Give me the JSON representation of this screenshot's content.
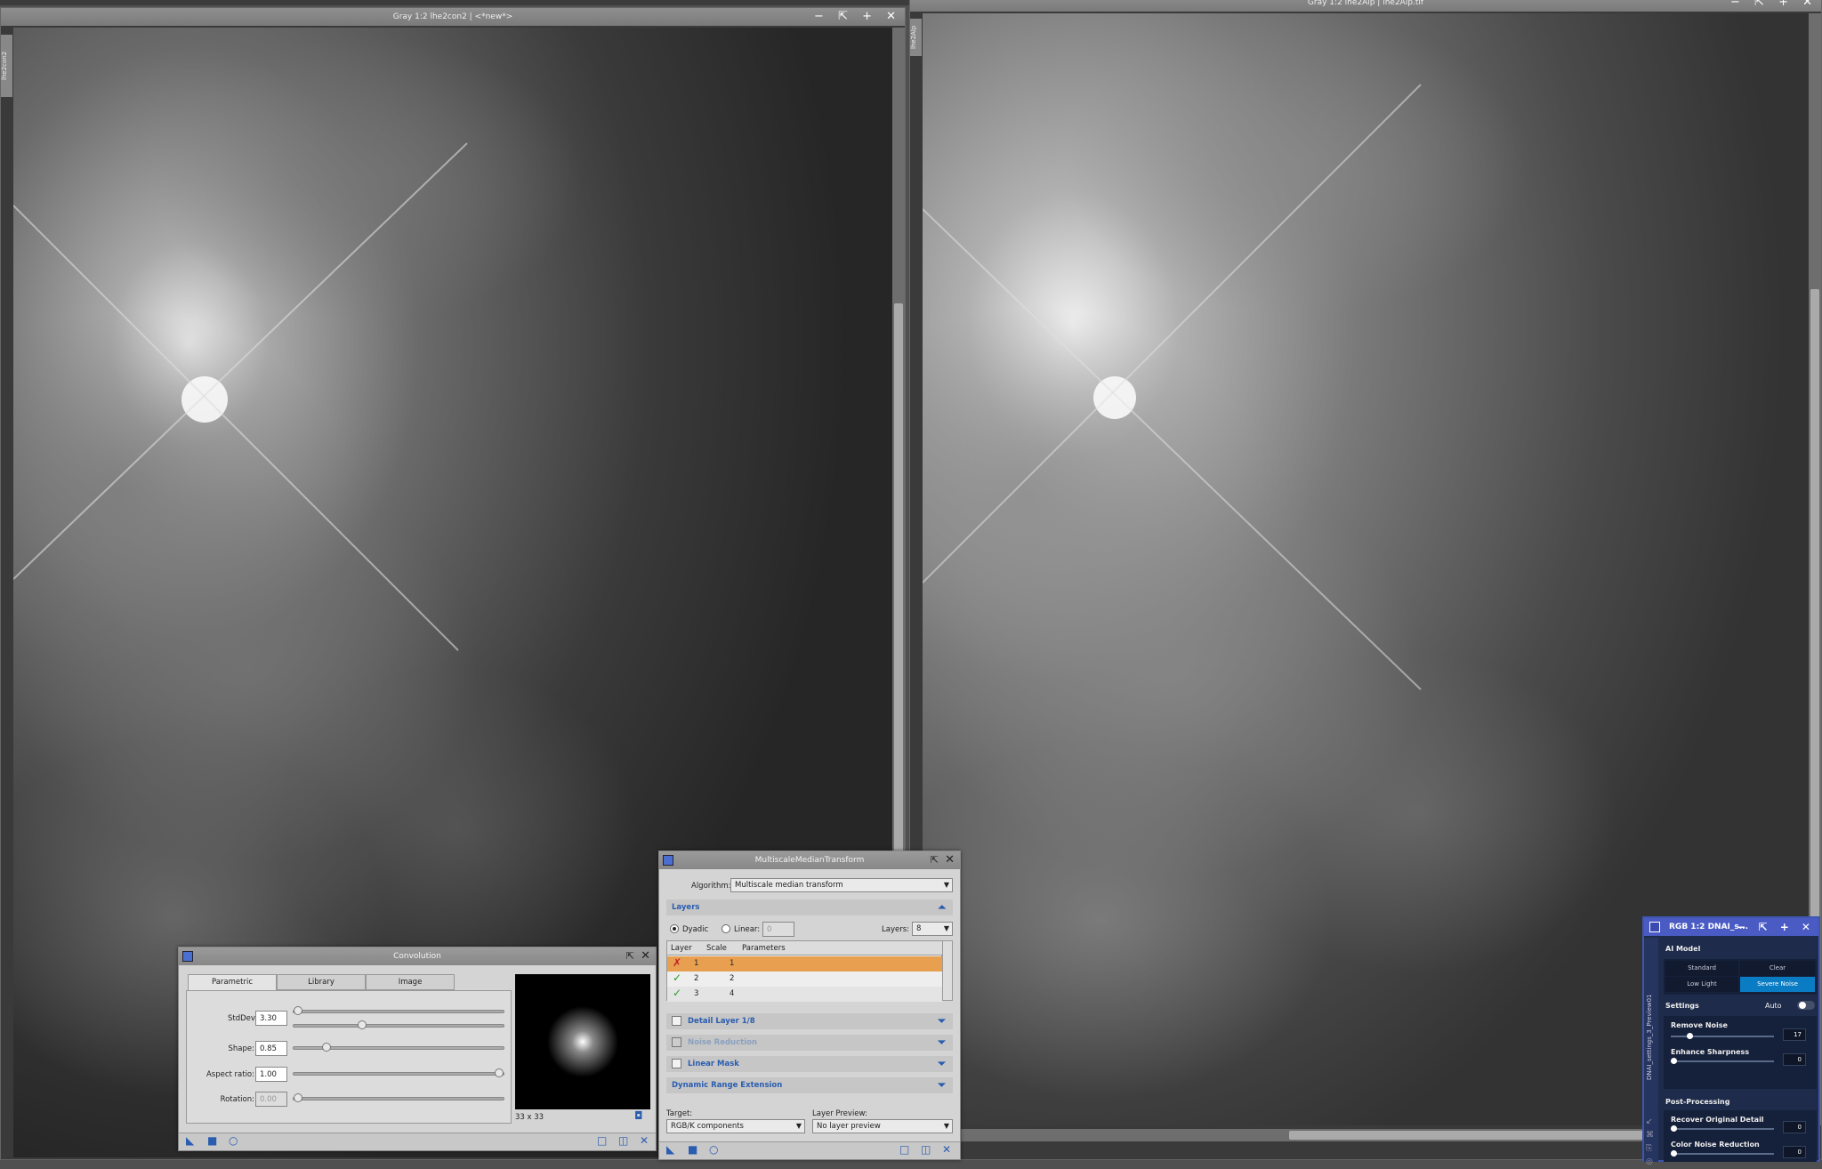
{
  "left_window": {
    "title": "Gray 1:2 lhe2con2 | <*new*>",
    "side_tab": "lhe2con2",
    "controls": [
      "−",
      "⇱",
      "+",
      "✕"
    ]
  },
  "right_window": {
    "title": "Gray 1:2 lhe2Alp | lhe2Alp.tif",
    "side_tab": "lhe2Alp",
    "controls": [
      "−",
      "⇱",
      "+",
      "✕"
    ]
  },
  "convolution": {
    "title": "Convolution",
    "tabs": [
      "Parametric",
      "Library",
      "Image"
    ],
    "stddev_label": "StdDev:",
    "stddev_value": "3.30",
    "shape_label": "Shape:",
    "shape_value": "0.85",
    "aspect_label": "Aspect ratio:",
    "aspect_value": "1.00",
    "rotation_label": "Rotation:",
    "rotation_value": "0.00",
    "kernel_size": "33 x 33"
  },
  "mmt": {
    "title": "MultiscaleMedianTransform",
    "algorithm_label": "Algorithm:",
    "algorithm_value": "Multiscale median transform",
    "layers_section": "Layers",
    "dyadic_label": "Dyadic",
    "linear_label": "Linear:",
    "linear_value": "0",
    "layers_label": "Layers:",
    "layers_value": "8",
    "table_headers": [
      "Layer",
      "Scale",
      "Parameters"
    ],
    "rows": [
      {
        "layer": "1",
        "scale": "1",
        "state": "disabled"
      },
      {
        "layer": "2",
        "scale": "2",
        "state": "enabled"
      },
      {
        "layer": "3",
        "scale": "4",
        "state": "enabled"
      }
    ],
    "detail_layer": "Detail Layer 1/8",
    "noise_reduction": "Noise Reduction",
    "linear_mask": "Linear Mask",
    "dynamic_range": "Dynamic Range Extension",
    "target_label": "Target:",
    "target_value": "RGB/K components",
    "layer_preview_label": "Layer Preview:",
    "layer_preview_value": "No layer preview"
  },
  "dnai": {
    "title": "RGB 1:2 DNAI_s...",
    "side_tab": "DNAI_settings_3_Preview01",
    "ai_model_label": "AI Model",
    "models": [
      "Standard",
      "Clear",
      "Low Light",
      "Severe Noise"
    ],
    "selected_model": "Severe Noise",
    "settings_label": "Settings",
    "auto_label": "Auto",
    "remove_noise_label": "Remove Noise",
    "remove_noise_value": "17",
    "remove_noise_level": 0.17,
    "enhance_sharpness_label": "Enhance Sharpness",
    "enhance_sharpness_value": "0",
    "post_processing_label": "Post-Processing",
    "recover_detail_label": "Recover Original Detail",
    "recover_detail_value": "0",
    "color_noise_label": "Color Noise Reduction",
    "color_noise_value": "0"
  },
  "colors": {
    "accent": "#2a5db0",
    "selected_row": "#e8a050",
    "dnai_selected": "#0a7cc4",
    "dnai_bg": "#1e2b4a"
  }
}
